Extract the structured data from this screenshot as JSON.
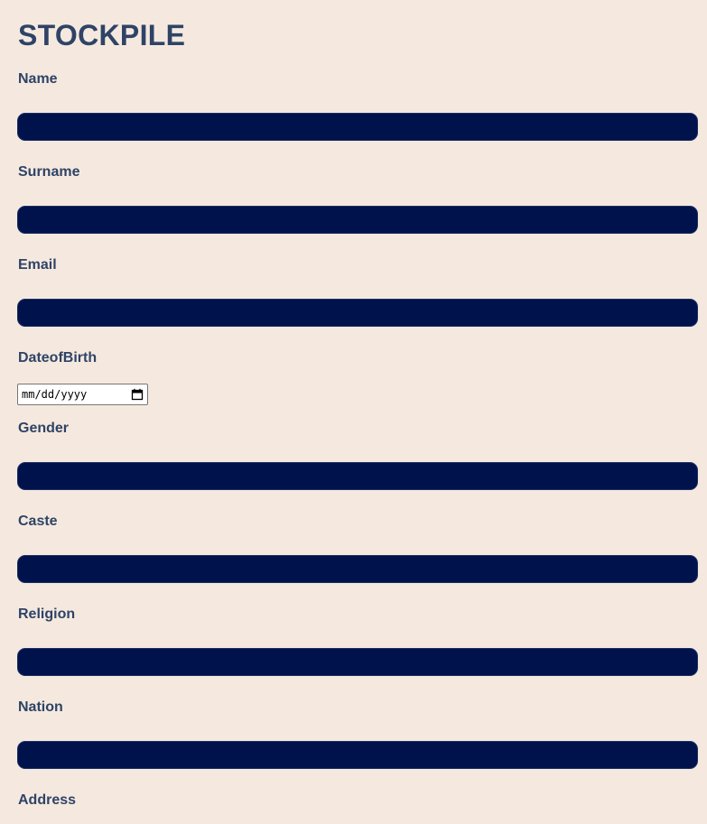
{
  "app": {
    "title": "STOCKPILE"
  },
  "form": {
    "name": {
      "label": "Name",
      "value": ""
    },
    "surname": {
      "label": "Surname",
      "value": ""
    },
    "email": {
      "label": "Email",
      "value": ""
    },
    "date_of_birth": {
      "label": "DateofBirth",
      "placeholder": "mm/dd/yyyy",
      "icon": "calendar-icon"
    },
    "gender": {
      "label": "Gender",
      "value": ""
    },
    "caste": {
      "label": "Caste",
      "value": ""
    },
    "religion": {
      "label": "Religion",
      "value": ""
    },
    "nation": {
      "label": "Nation",
      "value": ""
    },
    "address": {
      "label": "Address"
    }
  },
  "colors": {
    "background": "#f5e9df",
    "text": "#2f4366",
    "input_fill": "#00124b"
  }
}
